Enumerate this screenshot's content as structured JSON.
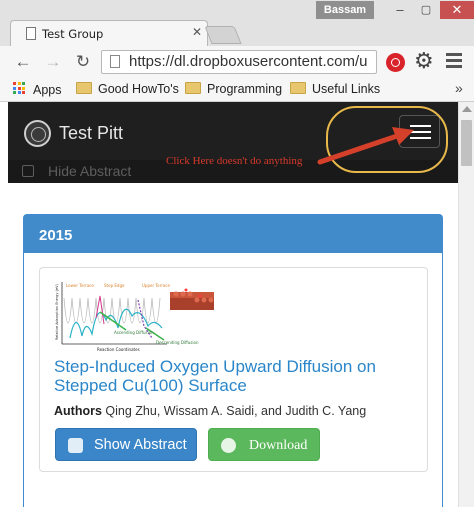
{
  "browser": {
    "tab_title": "Test Group",
    "tab_close": "✕",
    "profile_name": "Bassam",
    "window_controls": {
      "minimize": "–",
      "maximize": "▢",
      "close": "✕"
    },
    "nav": {
      "back": "←",
      "forward": "→",
      "reload": "↻"
    },
    "url": "https://dl.dropboxusercontent.com/u",
    "bookmarks": [
      {
        "label": "Apps",
        "icon": "apps-grid-icon"
      },
      {
        "label": "Good HowTo's",
        "icon": "folder-icon"
      },
      {
        "label": "Programming",
        "icon": "folder-icon"
      },
      {
        "label": "Useful Links",
        "icon": "folder-icon"
      }
    ],
    "bookmarks_overflow": "»",
    "extension_color": "#d8232a"
  },
  "site": {
    "brand": "Test Pitt",
    "hide_abstract_label": "Hide Abstract",
    "annotation_text": "Click Here doesn't do anything",
    "annotation_color": "#d93a2b",
    "highlight_color": "#e8b84b",
    "navbar_color": "#1f1f1f"
  },
  "publications": {
    "year": "2015",
    "heading_color": "#428bca",
    "items": [
      {
        "figure": {
          "labels": [
            "Lower Terrace",
            "Step Edge",
            "Upper Terrace",
            "Ascending Diffusion",
            "Descending Diffusion"
          ],
          "axis_y": "Relative Adsorption Energy (eV)",
          "axis_x": "Reaction Coordinates"
        },
        "title": "Step-Induced Oxygen Upward Diffusion on Stepped Cu(100) Surface",
        "authors_label": "Authors",
        "authors": "Qing Zhu, Wissam A. Saidi, and Judith C. Yang",
        "show_abstract_label": "Show Abstract",
        "download_label": "Download"
      }
    ]
  }
}
